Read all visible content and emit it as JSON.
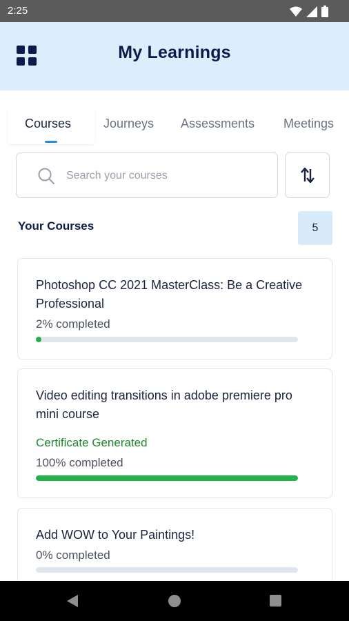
{
  "status_bar": {
    "time": "2:25",
    "icons": [
      "wifi-icon",
      "signal-icon",
      "battery-icon"
    ]
  },
  "header": {
    "title": "My Learnings",
    "menu_icon": "grid-icon",
    "background": "#dcedfb"
  },
  "tabs": [
    {
      "label": "Courses",
      "active": true
    },
    {
      "label": "Journeys",
      "active": false
    },
    {
      "label": "Assessments",
      "active": false
    },
    {
      "label": "Meetings",
      "active": false
    }
  ],
  "search": {
    "placeholder": "Search your courses",
    "value": ""
  },
  "sort_icon": "sort-icon",
  "section": {
    "title": "Your Courses",
    "count": "5"
  },
  "courses": [
    {
      "title": "Photoshop CC 2021 MasterClass: Be a Creative Professional",
      "progress_text": "2% completed",
      "progress": 0.02,
      "certificate": ""
    },
    {
      "title": "Video editing transitions in adobe premiere pro mini course",
      "progress_text": "100% completed",
      "progress": 1.0,
      "certificate": "Certificate Generated"
    },
    {
      "title": "Add WOW to Your Paintings!",
      "progress_text": "0% completed",
      "progress": 0.0,
      "certificate": ""
    }
  ],
  "colors": {
    "accent": "#1f8ee6",
    "title": "#0d1b4c",
    "progress": "#22b24c",
    "certificate": "#1d8a2a"
  }
}
